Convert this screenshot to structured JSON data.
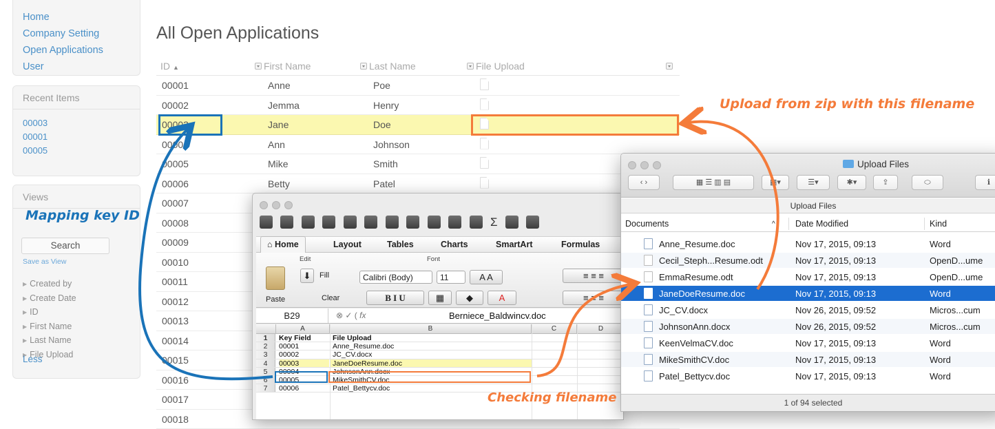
{
  "sidebar": {
    "nav": [
      "Home",
      "Company Setting",
      "Open Applications",
      "User"
    ],
    "recent": {
      "title": "Recent Items",
      "items": [
        "00003",
        "00001",
        "00005"
      ]
    },
    "views": {
      "title": "Views",
      "search_label": "Search",
      "save_label": "Save as View",
      "filters": [
        "Created by",
        "Create Date",
        "ID",
        "First Name",
        "Last Name",
        "File Upload"
      ],
      "less_label": "Less"
    }
  },
  "main": {
    "title": "All Open Applications",
    "columns": [
      "ID",
      "First Name",
      "Last Name",
      "File Upload"
    ],
    "rows": [
      {
        "id": "00001",
        "first": "Anne",
        "last": "Poe"
      },
      {
        "id": "00002",
        "first": "Jemma",
        "last": "Henry"
      },
      {
        "id": "00003",
        "first": "Jane",
        "last": "Doe"
      },
      {
        "id": "00004",
        "first": "Ann",
        "last": "Johnson"
      },
      {
        "id": "00005",
        "first": "Mike",
        "last": "Smith"
      },
      {
        "id": "00006",
        "first": "Betty",
        "last": "Patel"
      },
      {
        "id": "00007",
        "first": "",
        "last": ""
      },
      {
        "id": "00008",
        "first": "",
        "last": ""
      },
      {
        "id": "00009",
        "first": "",
        "last": ""
      },
      {
        "id": "00010",
        "first": "",
        "last": ""
      },
      {
        "id": "00011",
        "first": "",
        "last": ""
      },
      {
        "id": "00012",
        "first": "",
        "last": ""
      },
      {
        "id": "00013",
        "first": "",
        "last": ""
      },
      {
        "id": "00014",
        "first": "",
        "last": ""
      },
      {
        "id": "00015",
        "first": "",
        "last": ""
      },
      {
        "id": "00016",
        "first": "",
        "last": ""
      },
      {
        "id": "00017",
        "first": "",
        "last": ""
      },
      {
        "id": "00018",
        "first": "",
        "last": ""
      }
    ]
  },
  "annotations": {
    "upload_note": "Upload from zip with this filename",
    "mapping_note": "Mapping key ID",
    "checking_note": "Checking filename",
    "colors": {
      "orange": "#f47b3a",
      "blue": "#1a73b8",
      "highlight": "#fbf8b0"
    }
  },
  "excel": {
    "tabs": [
      "Home",
      "Layout",
      "Tables",
      "Charts",
      "SmartArt",
      "Formulas"
    ],
    "groups": {
      "edit": "Edit",
      "font": "Font"
    },
    "fill_label": "Fill",
    "clear_label": "Clear",
    "paste_label": "Paste",
    "font_name": "Calibri (Body)",
    "font_size": "11",
    "cell_ref": "B29",
    "formula_value": "Berniece_Baldwincv.doc",
    "col_headers": [
      "A",
      "B",
      "C",
      "D"
    ],
    "sheet_rows": [
      {
        "n": "1",
        "a": "Key Field",
        "b": "File Upload"
      },
      {
        "n": "2",
        "a": "00001",
        "b": "Anne_Resume.doc"
      },
      {
        "n": "3",
        "a": "00002",
        "b": "JC_CV.docx"
      },
      {
        "n": "4",
        "a": "00003",
        "b": "JaneDoeResume.doc"
      },
      {
        "n": "5",
        "a": "00004",
        "b": "JohnsonAnn.docx"
      },
      {
        "n": "6",
        "a": "00005",
        "b": "MikeSmithCV.doc"
      },
      {
        "n": "7",
        "a": "00006",
        "b": "Patel_Bettycv.doc"
      }
    ]
  },
  "finder": {
    "title": "Upload Files",
    "path_label": "Upload Files",
    "columns": [
      "Documents",
      "Date Modified",
      "Kind"
    ],
    "files": [
      {
        "name": "Anne_Resume.doc",
        "date": "Nov 17, 2015, 09:13",
        "kind": "Word"
      },
      {
        "name": "Cecil_Steph...Resume.odt",
        "date": "Nov 17, 2015, 09:13",
        "kind": "OpenD...ume"
      },
      {
        "name": "EmmaResume.odt",
        "date": "Nov 17, 2015, 09:13",
        "kind": "OpenD...ume"
      },
      {
        "name": "JaneDoeResume.doc",
        "date": "Nov 17, 2015, 09:13",
        "kind": "Word"
      },
      {
        "name": "JC_CV.docx",
        "date": "Nov 26, 2015, 09:52",
        "kind": "Micros...cum"
      },
      {
        "name": "JohnsonAnn.docx",
        "date": "Nov 26, 2015, 09:52",
        "kind": "Micros...cum"
      },
      {
        "name": "KeenVelmaCV.doc",
        "date": "Nov 17, 2015, 09:13",
        "kind": "Word"
      },
      {
        "name": "MikeSmithCV.doc",
        "date": "Nov 17, 2015, 09:13",
        "kind": "Word"
      },
      {
        "name": "Patel_Bettycv.doc",
        "date": "Nov 17, 2015, 09:13",
        "kind": "Word"
      }
    ],
    "status": "1 of 94 selected"
  }
}
